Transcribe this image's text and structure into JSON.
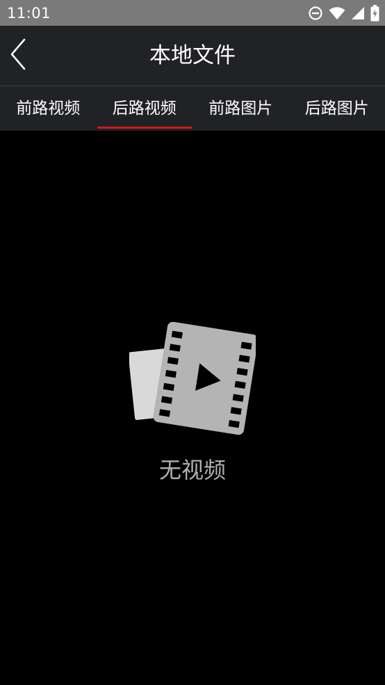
{
  "status_bar": {
    "time": "11:01",
    "icons": [
      "do-not-disturb-icon",
      "wifi-icon",
      "signal-icon",
      "battery-charging-icon"
    ]
  },
  "header": {
    "title": "本地文件",
    "back_icon": "chevron-left-icon"
  },
  "tabs": [
    {
      "label": "前路视频",
      "selected": false
    },
    {
      "label": "后路视频",
      "selected": true
    },
    {
      "label": "前路图片",
      "selected": false
    },
    {
      "label": "后路图片",
      "selected": false
    }
  ],
  "empty_state": {
    "icon": "video-film-icon",
    "message": "无视频"
  },
  "colors": {
    "status_bar": "#7a7a7a",
    "toolbar": "#212225",
    "background": "#000000",
    "accent": "#d0181c",
    "empty_text": "#b0b0b0"
  }
}
